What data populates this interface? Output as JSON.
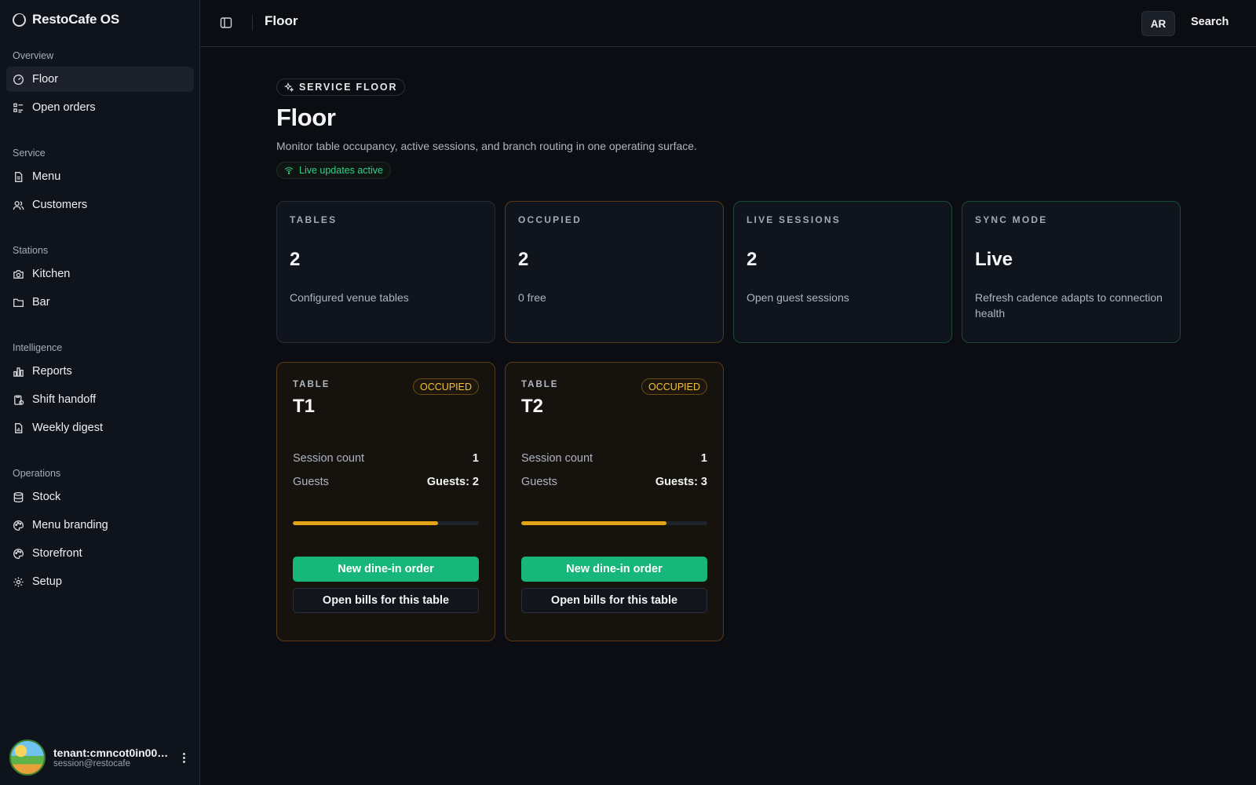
{
  "app": {
    "name": "RestoCafe OS"
  },
  "sidebar": {
    "sections": [
      {
        "label": "Overview",
        "items": [
          {
            "label": "Floor",
            "icon": "gauge-icon",
            "active": true
          },
          {
            "label": "Open orders",
            "icon": "list-icon"
          }
        ]
      },
      {
        "label": "Service",
        "items": [
          {
            "label": "Menu",
            "icon": "file-icon"
          },
          {
            "label": "Customers",
            "icon": "users-icon"
          }
        ]
      },
      {
        "label": "Stations",
        "items": [
          {
            "label": "Kitchen",
            "icon": "camera-icon"
          },
          {
            "label": "Bar",
            "icon": "folder-icon"
          }
        ]
      },
      {
        "label": "Intelligence",
        "items": [
          {
            "label": "Reports",
            "icon": "bar-chart-icon"
          },
          {
            "label": "Shift handoff",
            "icon": "clipboard-icon"
          },
          {
            "label": "Weekly digest",
            "icon": "file-chart-icon"
          }
        ]
      },
      {
        "label": "Operations",
        "items": [
          {
            "label": "Stock",
            "icon": "database-icon"
          },
          {
            "label": "Menu branding",
            "icon": "palette-icon"
          },
          {
            "label": "Storefront",
            "icon": "palette-icon"
          },
          {
            "label": "Setup",
            "icon": "gear-icon"
          }
        ]
      }
    ],
    "user": {
      "name": "tenant:cmncot0in000…",
      "email": "session@restocafe"
    }
  },
  "topbar": {
    "title": "Floor",
    "lang": "AR",
    "search": "Search"
  },
  "main": {
    "eyebrow": "SERVICE FLOOR",
    "title": "Floor",
    "description": "Monitor table occupancy, active sessions, and branch routing in one operating surface.",
    "live": "Live updates active",
    "stats": [
      {
        "label": "TABLES",
        "value": "2",
        "sub": "Configured venue tables"
      },
      {
        "label": "OCCUPIED",
        "value": "2",
        "sub": "0 free"
      },
      {
        "label": "LIVE SESSIONS",
        "value": "2",
        "sub": "Open guest sessions"
      },
      {
        "label": "SYNC MODE",
        "value": "Live",
        "sub": "Refresh cadence adapts to connection health"
      }
    ],
    "tables": [
      {
        "label": "TABLE",
        "name": "T1",
        "status": "OCCUPIED",
        "session_label": "Session count",
        "session_value": "1",
        "guests_label": "Guests",
        "guests_value": "Guests: 2",
        "progress": 0.78,
        "primary": "New dine-in order",
        "secondary": "Open bills for this table"
      },
      {
        "label": "TABLE",
        "name": "T2",
        "status": "OCCUPIED",
        "session_label": "Session count",
        "session_value": "1",
        "guests_label": "Guests",
        "guests_value": "Guests: 3",
        "progress": 0.78,
        "primary": "New dine-in order",
        "secondary": "Open bills for this table"
      }
    ]
  },
  "colors": {
    "accent": "#17b67a",
    "warning": "#e2a317",
    "background": "#0b0d12"
  }
}
